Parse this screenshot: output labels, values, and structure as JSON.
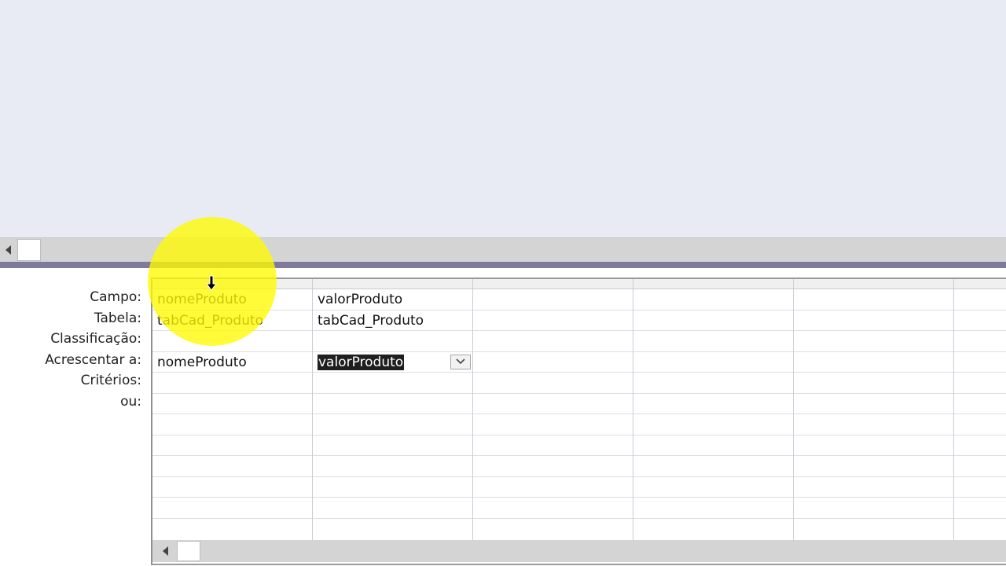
{
  "qbe": {
    "row_labels": [
      "Campo:",
      "Tabela:",
      "Classificação:",
      "Acrescentar a:",
      "Critérios:",
      "ou:"
    ],
    "columns": [
      {
        "campo": "nomeProduto",
        "tabela": "tabCad_Produto",
        "classificacao": "",
        "acrescentar": "nomeProduto",
        "criterios": "",
        "ou": ""
      },
      {
        "campo": "valorProduto",
        "tabela": "tabCad_Produto",
        "classificacao": "",
        "acrescentar": "valorProduto",
        "criterios": "",
        "ou": ""
      },
      {
        "campo": "",
        "tabela": "",
        "classificacao": "",
        "acrescentar": "",
        "criterios": "",
        "ou": ""
      },
      {
        "campo": "",
        "tabela": "",
        "classificacao": "",
        "acrescentar": "",
        "criterios": "",
        "ou": ""
      },
      {
        "campo": "",
        "tabela": "",
        "classificacao": "",
        "acrescentar": "",
        "criterios": "",
        "ou": ""
      },
      {
        "campo": "",
        "tabela": "",
        "classificacao": "",
        "acrescentar": "",
        "criterios": "",
        "ou": ""
      }
    ],
    "selected_cell": {
      "column": 1,
      "row": "acrescentar"
    }
  },
  "colors": {
    "top_pane": "#e8ebf3",
    "splitter": "#7d7a9d",
    "cursor_highlight": "#fff700",
    "selection": "#1f1f1f"
  },
  "icons": {
    "scroll_left": "triangle-left-icon",
    "dropdown": "chevron-down-icon",
    "cursor": "down-arrow-cursor-icon"
  }
}
